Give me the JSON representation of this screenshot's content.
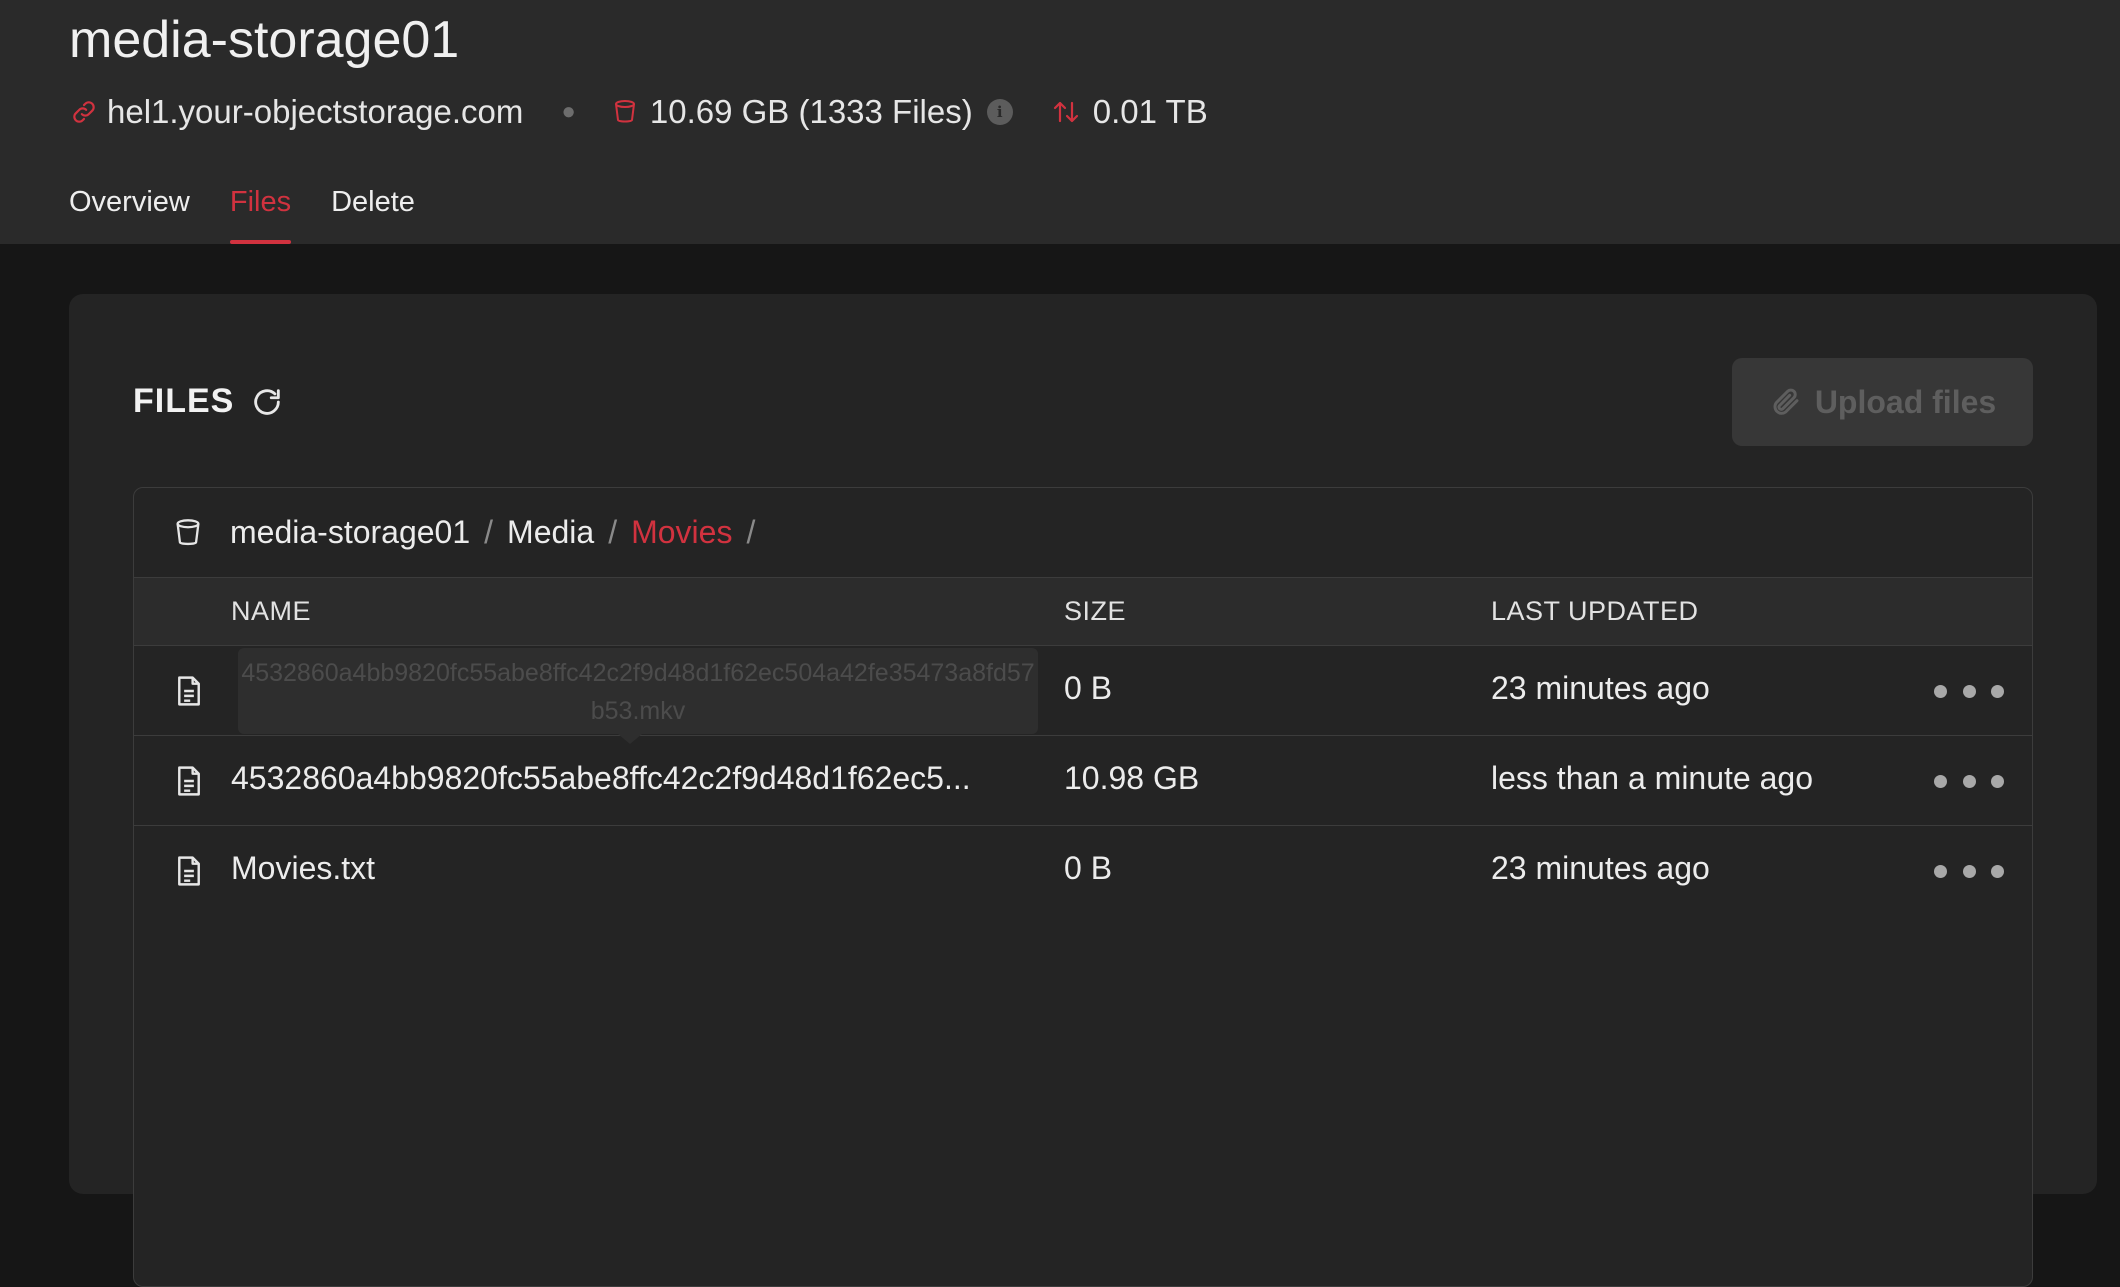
{
  "bucket": {
    "title": "media-storage01",
    "endpoint": "hel1.your-objectstorage.com",
    "usage": "10.69 GB (1333 Files)",
    "traffic": "0.01 TB"
  },
  "tabs": [
    {
      "label": "Overview"
    },
    {
      "label": "Files"
    },
    {
      "label": "Delete"
    }
  ],
  "files_panel": {
    "heading": "FILES",
    "upload_label": "Upload files",
    "breadcrumb": [
      {
        "label": "media-storage01"
      },
      {
        "label": "Media"
      },
      {
        "label": "Movies"
      }
    ],
    "columns": {
      "name": "NAME",
      "size": "SIZE",
      "updated": "LAST UPDATED"
    },
    "rows": [
      {
        "name": "",
        "size": "0 B",
        "updated": "23 minutes ago"
      },
      {
        "name": "4532860a4bb9820fc55abe8ffc42c2f9d48d1f62ec5...",
        "size": "10.98 GB",
        "updated": "less than a minute ago"
      },
      {
        "name": "Movies.txt",
        "size": "0 B",
        "updated": "23 minutes ago"
      }
    ],
    "tooltip": "4532860a4bb9820fc55abe8ffc42c2f9d48d1f62ec504a42fe35473a8fd57b53.mkv"
  },
  "colors": {
    "accent": "#d1323f",
    "header_bg": "#2a2a2a",
    "page_bg": "#161616",
    "panel_bg": "#242424"
  },
  "icons": {
    "endpoint": "link-icon",
    "usage": "bucket-icon",
    "traffic": "arrows-up-down-icon",
    "info": "info-icon",
    "refresh": "refresh-icon",
    "upload": "paperclip-icon",
    "breadcrumb_root": "bucket-icon",
    "file": "file-icon",
    "row_menu": "more-horizontal-icon"
  }
}
